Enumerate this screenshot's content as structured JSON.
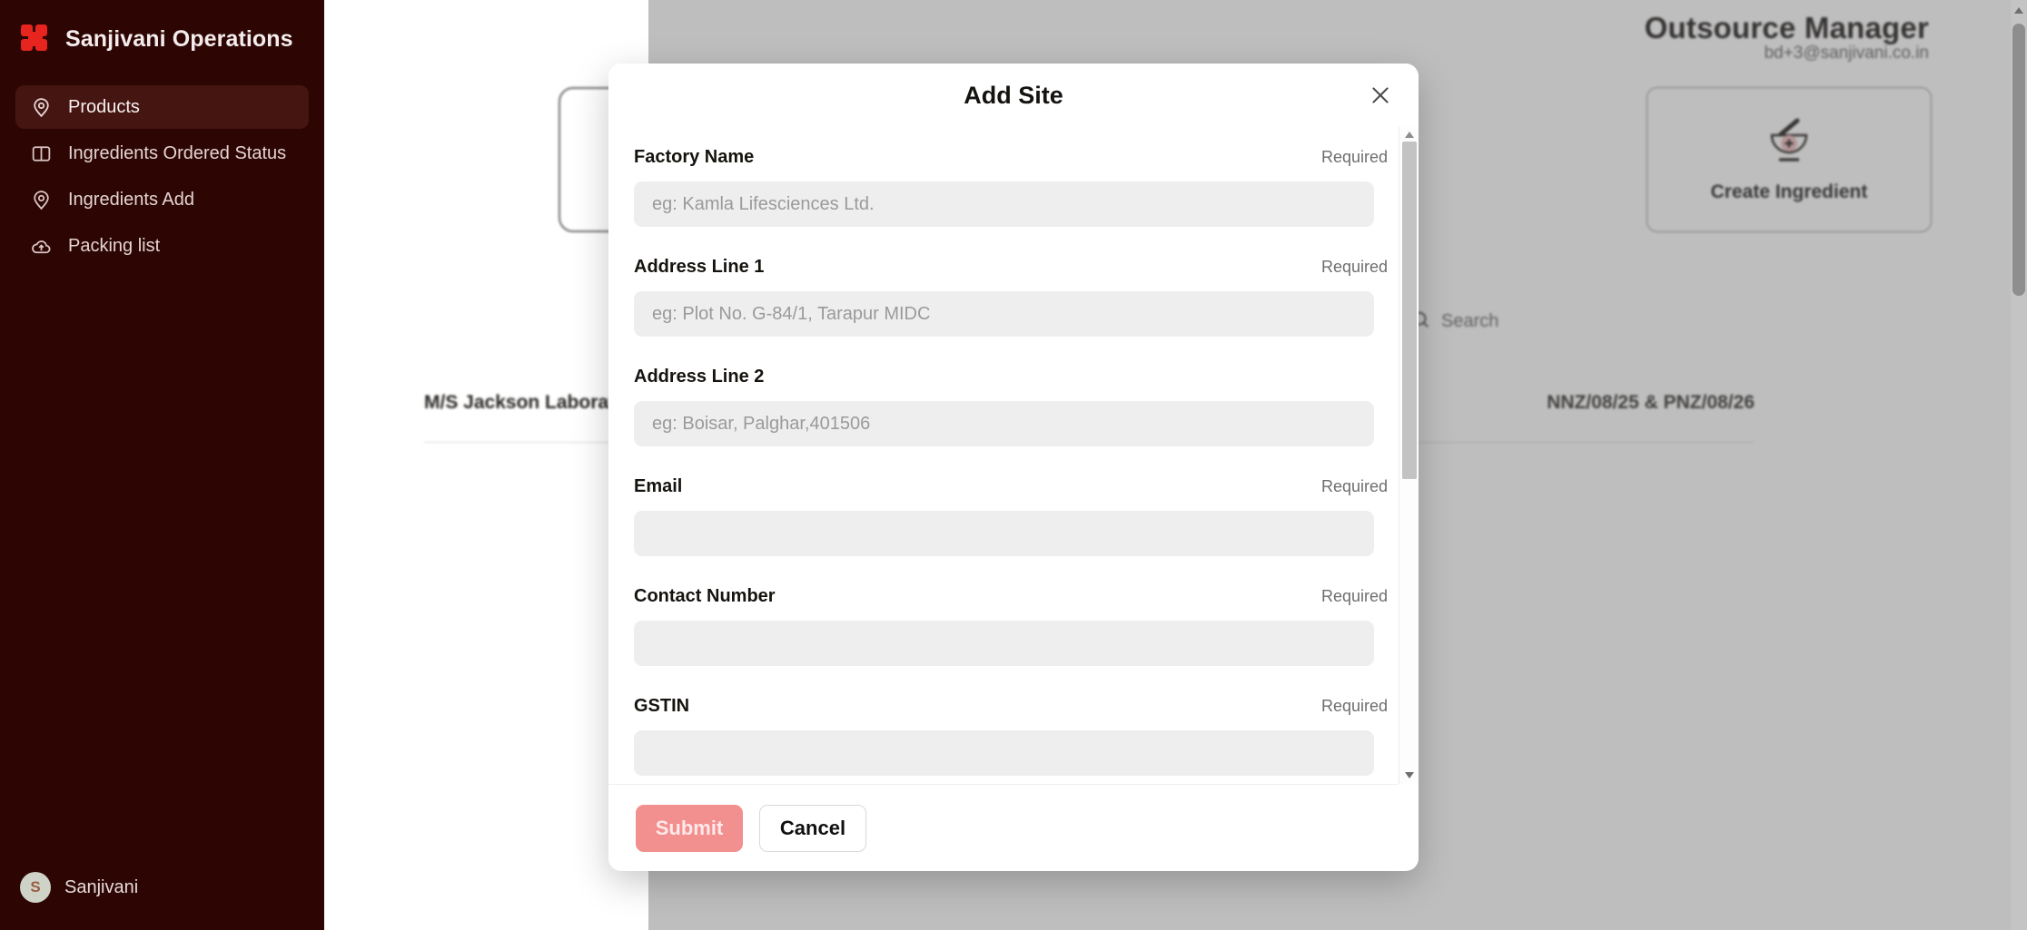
{
  "sidebar": {
    "brand": "Sanjivani Operations",
    "logo_icon": "grid-logo-icon",
    "items": [
      {
        "label": "Products",
        "icon": "map-pin-icon",
        "active": true
      },
      {
        "label": "Ingredients Ordered Status",
        "icon": "book-icon",
        "active": false
      },
      {
        "label": "Ingredients Add",
        "icon": "map-pin-icon",
        "active": false
      },
      {
        "label": "Packing list",
        "icon": "cloud-upload-icon",
        "active": false
      }
    ],
    "user": {
      "initial": "S",
      "name": "Sanjivani"
    }
  },
  "header": {
    "title": "Outsource Manager",
    "email": "bd+3@sanjivani.co.in"
  },
  "actions": {
    "create_ingredient_label": "Create Ingredient",
    "create_ingredient_icon": "mortar-pestle-plus-icon"
  },
  "search": {
    "placeholder": "Search",
    "icon": "search-icon"
  },
  "table": {
    "rows": [
      {
        "name": "M/S Jackson Laboratories Pvt Ltd",
        "code": "NNZ/08/25 & PNZ/08/26"
      }
    ]
  },
  "modal": {
    "title": "Add Site",
    "close_icon": "close-icon",
    "required_label": "Required",
    "fields": [
      {
        "label": "Factory Name",
        "required": "Required",
        "placeholder": "eg: Kamla Lifesciences Ltd.",
        "value": ""
      },
      {
        "label": "Address Line 1",
        "required": "Required",
        "placeholder": "eg: Plot No. G-84/1, Tarapur MIDC",
        "value": ""
      },
      {
        "label": "Address Line 2",
        "required": "",
        "placeholder": "eg: Boisar, Palghar,401506",
        "value": ""
      },
      {
        "label": "Email",
        "required": "Required",
        "placeholder": "",
        "value": ""
      },
      {
        "label": "Contact Number",
        "required": "Required",
        "placeholder": "",
        "value": ""
      },
      {
        "label": "GSTIN",
        "required": "Required",
        "placeholder": "",
        "value": ""
      }
    ],
    "submit_label": "Submit",
    "cancel_label": "Cancel"
  },
  "colors": {
    "sidebar_bg": "#2d0604",
    "sidebar_active": "#451512",
    "brand_red": "#e8241f",
    "submit_pink": "#f28f8f",
    "input_bg": "#eeeeee"
  }
}
